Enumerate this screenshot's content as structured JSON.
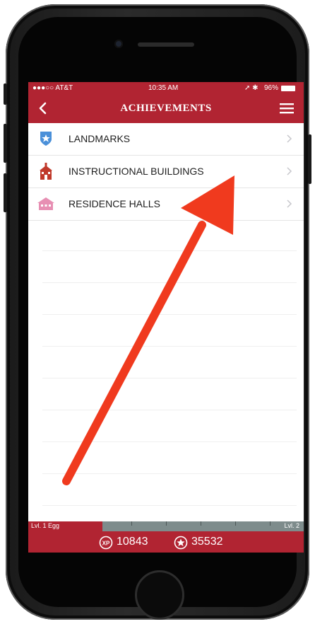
{
  "status": {
    "carrier": "●●●○○ AT&T",
    "time": "10:35 AM",
    "battery": "96%"
  },
  "nav": {
    "title": "ACHIEVEMENTS"
  },
  "items": [
    {
      "label": "LANDMARKS",
      "icon": "star-shield-icon",
      "icon_color": "#4a90d9"
    },
    {
      "label": "INSTRUCTIONAL BUILDINGS",
      "icon": "schoolhouse-icon",
      "icon_color": "#c0392b"
    },
    {
      "label": "RESIDENCE HALLS",
      "icon": "house-icon",
      "icon_color": "#e78fb3"
    }
  ],
  "level": {
    "current": "Lvl. 1 Egg",
    "next": "Lvl. 2",
    "progress": 0.27
  },
  "scores": {
    "xp": "10843",
    "points": "35532"
  },
  "colors": {
    "brand": "#b12432",
    "level_track": "#7e8c8c",
    "annotation_arrow": "#f03a1e"
  }
}
